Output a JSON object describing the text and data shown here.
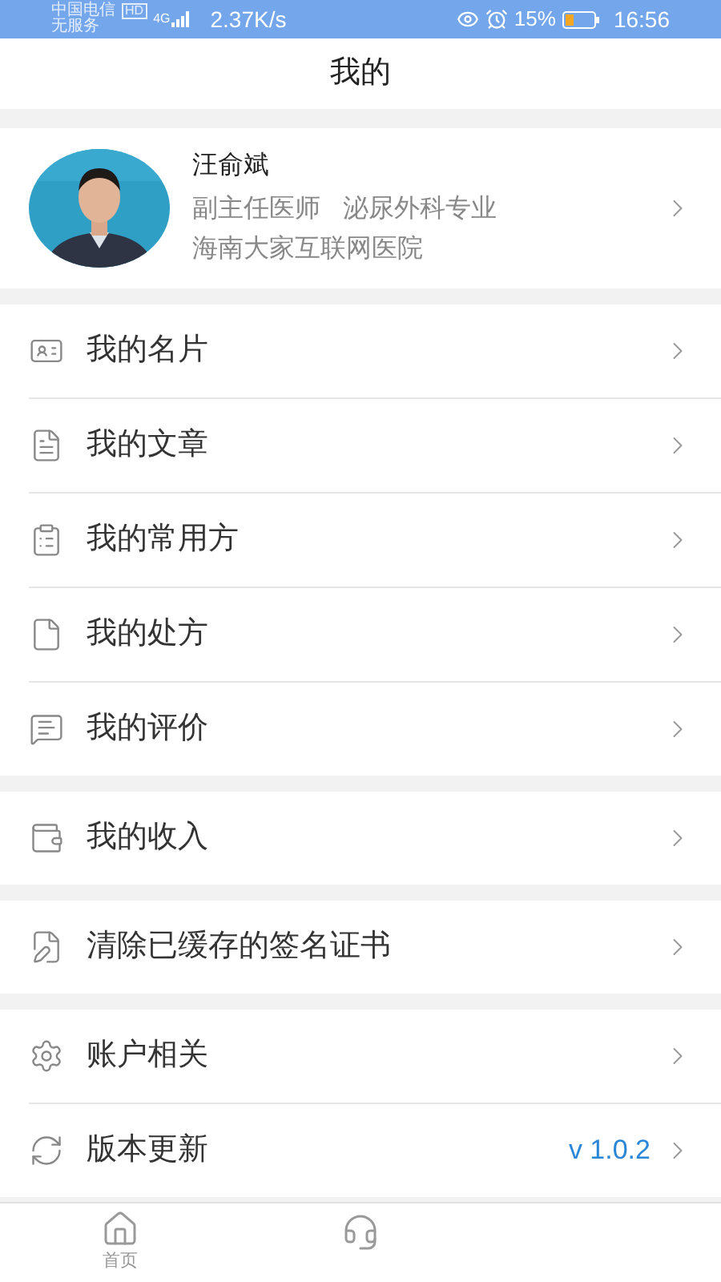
{
  "status_bar": {
    "carrier": "中国电信",
    "hd": "HD",
    "service": "无服务",
    "network": "4G",
    "speed": "2.37K/s",
    "battery": "15%",
    "time": "16:56"
  },
  "header": {
    "title": "我的"
  },
  "profile": {
    "name": "汪俞斌",
    "title": "副主任医师",
    "specialty": "泌尿外科专业",
    "hospital": "海南大家互联网医院"
  },
  "groups": [
    {
      "items": [
        {
          "label": "我的名片"
        },
        {
          "label": "我的文章"
        },
        {
          "label": "我的常用方"
        },
        {
          "label": "我的处方"
        },
        {
          "label": "我的评价"
        }
      ]
    },
    {
      "items": [
        {
          "label": "我的收入"
        }
      ]
    },
    {
      "items": [
        {
          "label": "清除已缓存的签名证书"
        }
      ]
    },
    {
      "items": [
        {
          "label": "账户相关"
        },
        {
          "label": "版本更新",
          "value": "v 1.0.2"
        }
      ]
    }
  ],
  "bottom_nav": {
    "tabs": [
      {
        "label": "首页",
        "selected": false
      }
    ]
  }
}
